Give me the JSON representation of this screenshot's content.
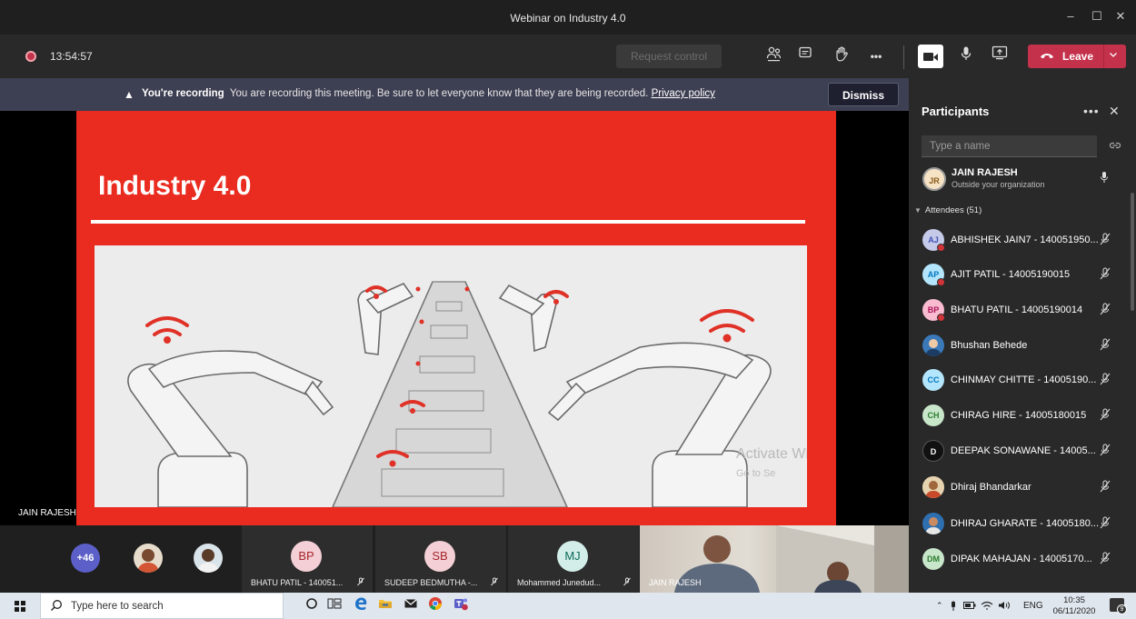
{
  "window": {
    "title": "Webinar on Industry 4.0",
    "controls": [
      "–",
      "☐",
      "✕"
    ]
  },
  "toolbar": {
    "timer": "13:54:57",
    "request_control": "Request control",
    "icons": [
      "participants-icon",
      "chat-icon",
      "raise-hand-icon",
      "more-icon"
    ],
    "more_glyph": "•••",
    "leave_label": "Leave",
    "colors": {
      "leave": "#c4314b",
      "toolbar": "#292929"
    }
  },
  "banner": {
    "warn_glyph": "▲",
    "heading": "You're recording",
    "message": "You are recording this meeting. Be sure to let everyone know that they are being recorded.",
    "policy_link": "Privacy policy",
    "dismiss": "Dismiss"
  },
  "slide": {
    "title": "Industry 4.0",
    "watermark_line1": "Activate Wi",
    "watermark_line2": "Go to Se",
    "colors": {
      "background": "#ea2b1f"
    }
  },
  "stage": {
    "speaker_name": "JAIN RAJESH"
  },
  "strip": {
    "overflow": "+46",
    "tiles": [
      {
        "initials": "BP",
        "name": "BHATU PATIL - 140051...",
        "avatar_bg": "#f4d0d6",
        "avatar_fg": "#a4262c"
      },
      {
        "initials": "SB",
        "name": "SUDEEP BEDMUTHA -...",
        "avatar_bg": "#f4d0d6",
        "avatar_fg": "#a4262c"
      },
      {
        "initials": "MJ",
        "name": "Mohammed Junedud...",
        "avatar_bg": "#d3eee8",
        "avatar_fg": "#0b6a5b"
      }
    ],
    "video_name": "JAIN RAJESH"
  },
  "participants": {
    "title": "Participants",
    "more_glyph": "•••",
    "close_glyph": "✕",
    "search_placeholder": "Type a name",
    "organizer": {
      "initials": "JR",
      "name": "JAIN RAJESH",
      "subtitle": "Outside your organization"
    },
    "attendees_heading": "Attendees (51)",
    "attendees": [
      {
        "initials": "AJ",
        "name": "ABHISHEK JAIN7 - 140051950...",
        "bg": "#c5cae9",
        "fg": "#3f51b5"
      },
      {
        "initials": "AP",
        "name": "AJIT PATIL - 14005190015",
        "bg": "#b3e5fc",
        "fg": "#0277bd"
      },
      {
        "initials": "BP",
        "name": "BHATU PATIL - 14005190014",
        "bg": "#f8bbd0",
        "fg": "#ad1457"
      },
      {
        "initials": "",
        "name": "Bhushan Behede",
        "bg": "#3a78b8",
        "fg": "#ffffff",
        "photo": true
      },
      {
        "initials": "CC",
        "name": "CHINMAY CHITTE - 14005190...",
        "bg": "#b3e5fc",
        "fg": "#0277bd"
      },
      {
        "initials": "CH",
        "name": "CHIRAG HIRE - 14005180015",
        "bg": "#c8e6c9",
        "fg": "#2e7d32"
      },
      {
        "initials": "D",
        "name": "DEEPAK SONAWANE - 14005...",
        "bg": "#111111",
        "fg": "#ffffff"
      },
      {
        "initials": "",
        "name": "Dhiraj Bhandarkar",
        "bg": "#d9a35f",
        "fg": "#ffffff",
        "photo": true
      },
      {
        "initials": "",
        "name": "DHIRAJ GHARATE - 14005180...",
        "bg": "#2e6fb0",
        "fg": "#ffffff",
        "photo": true
      },
      {
        "initials": "DM",
        "name": "DIPAK MAHAJAN - 14005170...",
        "bg": "#c8e6c9",
        "fg": "#2e7d32"
      }
    ]
  },
  "taskbar": {
    "search_placeholder": "Type here to search",
    "language": "ENG",
    "time": "10:35",
    "date": "06/11/2020",
    "notification_count": "9"
  }
}
